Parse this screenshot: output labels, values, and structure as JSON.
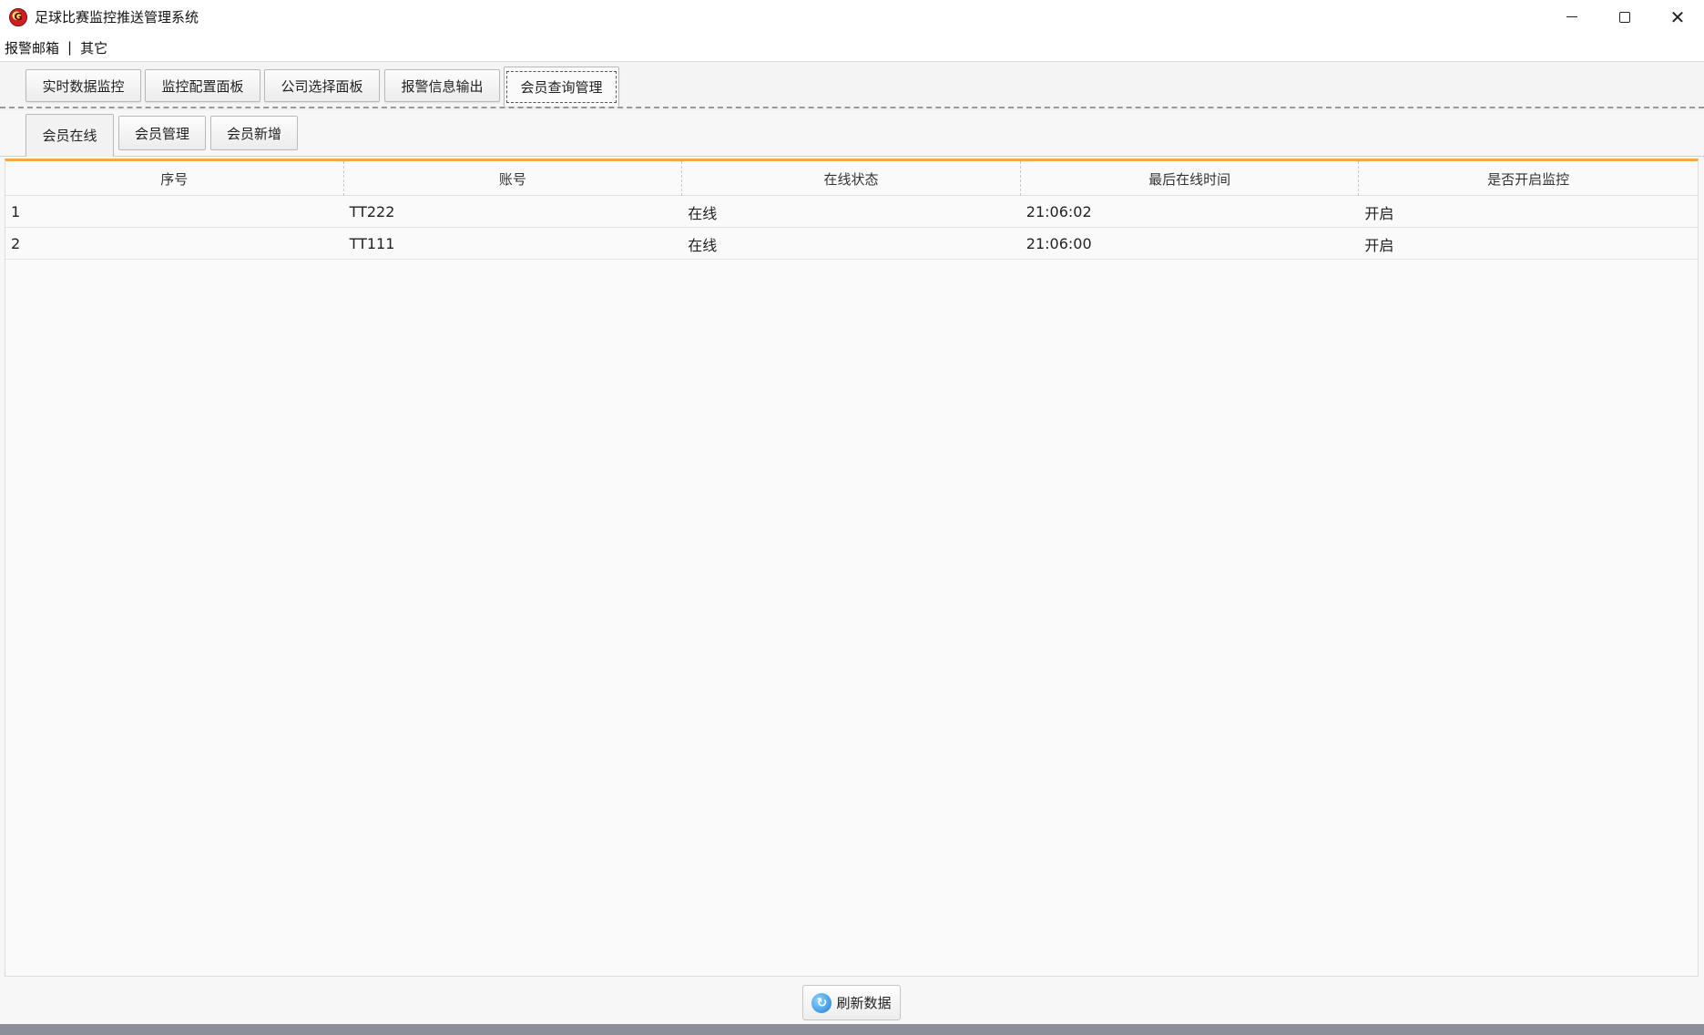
{
  "window": {
    "title": "足球比赛监控推送管理系统",
    "icon": "app-logo-icon",
    "icon_letter": "G",
    "controls": {
      "close_glyph": "✕"
    }
  },
  "menu": {
    "items": [
      "报警邮箱",
      "其它"
    ],
    "separator": "|"
  },
  "main_tabs": [
    {
      "label": "实时数据监控"
    },
    {
      "label": "监控配置面板"
    },
    {
      "label": "公司选择面板"
    },
    {
      "label": "报警信息输出"
    },
    {
      "label": "会员查询管理",
      "active": true
    }
  ],
  "sub_tabs": [
    {
      "label": "会员在线",
      "active": true
    },
    {
      "label": "会员管理"
    },
    {
      "label": "会员新增"
    }
  ],
  "table": {
    "columns": [
      "序号",
      "账号",
      "在线状态",
      "最后在线时间",
      "是否开启监控"
    ],
    "rows": [
      [
        "1",
        "TT222",
        "在线",
        "21:06:02",
        "开启"
      ],
      [
        "2",
        "TT111",
        "在线",
        "21:06:00",
        "开启"
      ]
    ]
  },
  "refresh": {
    "label": "刷新数据",
    "icon": "refresh-icon",
    "icon_glyph": "↻"
  },
  "colors": {
    "accent_line": "#f0a94a",
    "refresh_icon": "#1f7fd6"
  }
}
